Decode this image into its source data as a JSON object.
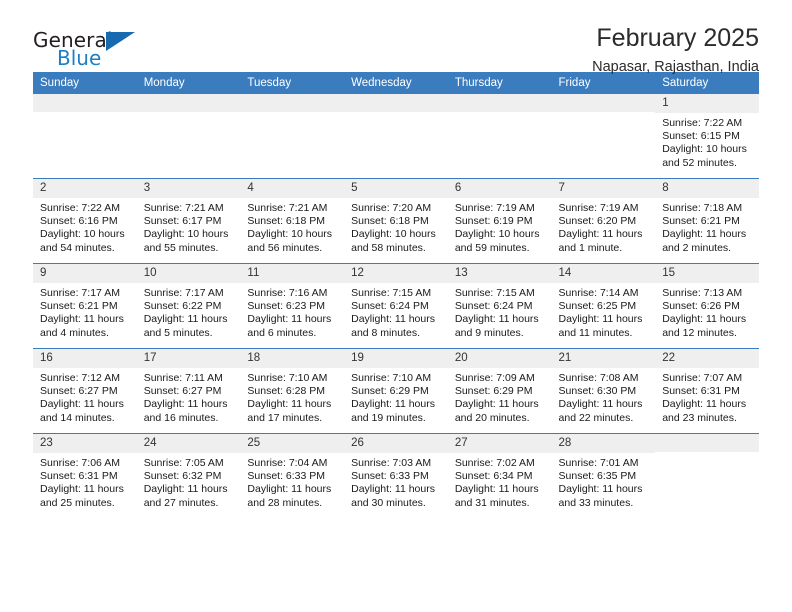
{
  "brand": {
    "name_part1": "General",
    "name_part2": "Blue",
    "triangle_color": "#1769b0",
    "blue_text_color": "#1c7fc4"
  },
  "header": {
    "title": "February 2025",
    "subtitle": "Napasar, Rajasthan, India"
  },
  "theme": {
    "header_blue": "#3b7cbe",
    "daynum_band": "#efefef",
    "text": "#1a1a1a"
  },
  "weekday_headers": [
    "Sunday",
    "Monday",
    "Tuesday",
    "Wednesday",
    "Thursday",
    "Friday",
    "Saturday"
  ],
  "weeks": [
    [
      {
        "day": "",
        "sunrise": "",
        "sunset": "",
        "daylight": "",
        "empty": true
      },
      {
        "day": "",
        "sunrise": "",
        "sunset": "",
        "daylight": "",
        "empty": true
      },
      {
        "day": "",
        "sunrise": "",
        "sunset": "",
        "daylight": "",
        "empty": true
      },
      {
        "day": "",
        "sunrise": "",
        "sunset": "",
        "daylight": "",
        "empty": true
      },
      {
        "day": "",
        "sunrise": "",
        "sunset": "",
        "daylight": "",
        "empty": true
      },
      {
        "day": "",
        "sunrise": "",
        "sunset": "",
        "daylight": "",
        "empty": true
      },
      {
        "day": "1",
        "sunrise": "Sunrise: 7:22 AM",
        "sunset": "Sunset: 6:15 PM",
        "daylight": "Daylight: 10 hours and 52 minutes.",
        "empty": false
      }
    ],
    [
      {
        "day": "2",
        "sunrise": "Sunrise: 7:22 AM",
        "sunset": "Sunset: 6:16 PM",
        "daylight": "Daylight: 10 hours and 54 minutes.",
        "empty": false
      },
      {
        "day": "3",
        "sunrise": "Sunrise: 7:21 AM",
        "sunset": "Sunset: 6:17 PM",
        "daylight": "Daylight: 10 hours and 55 minutes.",
        "empty": false
      },
      {
        "day": "4",
        "sunrise": "Sunrise: 7:21 AM",
        "sunset": "Sunset: 6:18 PM",
        "daylight": "Daylight: 10 hours and 56 minutes.",
        "empty": false
      },
      {
        "day": "5",
        "sunrise": "Sunrise: 7:20 AM",
        "sunset": "Sunset: 6:18 PM",
        "daylight": "Daylight: 10 hours and 58 minutes.",
        "empty": false
      },
      {
        "day": "6",
        "sunrise": "Sunrise: 7:19 AM",
        "sunset": "Sunset: 6:19 PM",
        "daylight": "Daylight: 10 hours and 59 minutes.",
        "empty": false
      },
      {
        "day": "7",
        "sunrise": "Sunrise: 7:19 AM",
        "sunset": "Sunset: 6:20 PM",
        "daylight": "Daylight: 11 hours and 1 minute.",
        "empty": false
      },
      {
        "day": "8",
        "sunrise": "Sunrise: 7:18 AM",
        "sunset": "Sunset: 6:21 PM",
        "daylight": "Daylight: 11 hours and 2 minutes.",
        "empty": false
      }
    ],
    [
      {
        "day": "9",
        "sunrise": "Sunrise: 7:17 AM",
        "sunset": "Sunset: 6:21 PM",
        "daylight": "Daylight: 11 hours and 4 minutes.",
        "empty": false
      },
      {
        "day": "10",
        "sunrise": "Sunrise: 7:17 AM",
        "sunset": "Sunset: 6:22 PM",
        "daylight": "Daylight: 11 hours and 5 minutes.",
        "empty": false
      },
      {
        "day": "11",
        "sunrise": "Sunrise: 7:16 AM",
        "sunset": "Sunset: 6:23 PM",
        "daylight": "Daylight: 11 hours and 6 minutes.",
        "empty": false
      },
      {
        "day": "12",
        "sunrise": "Sunrise: 7:15 AM",
        "sunset": "Sunset: 6:24 PM",
        "daylight": "Daylight: 11 hours and 8 minutes.",
        "empty": false
      },
      {
        "day": "13",
        "sunrise": "Sunrise: 7:15 AM",
        "sunset": "Sunset: 6:24 PM",
        "daylight": "Daylight: 11 hours and 9 minutes.",
        "empty": false
      },
      {
        "day": "14",
        "sunrise": "Sunrise: 7:14 AM",
        "sunset": "Sunset: 6:25 PM",
        "daylight": "Daylight: 11 hours and 11 minutes.",
        "empty": false
      },
      {
        "day": "15",
        "sunrise": "Sunrise: 7:13 AM",
        "sunset": "Sunset: 6:26 PM",
        "daylight": "Daylight: 11 hours and 12 minutes.",
        "empty": false
      }
    ],
    [
      {
        "day": "16",
        "sunrise": "Sunrise: 7:12 AM",
        "sunset": "Sunset: 6:27 PM",
        "daylight": "Daylight: 11 hours and 14 minutes.",
        "empty": false
      },
      {
        "day": "17",
        "sunrise": "Sunrise: 7:11 AM",
        "sunset": "Sunset: 6:27 PM",
        "daylight": "Daylight: 11 hours and 16 minutes.",
        "empty": false
      },
      {
        "day": "18",
        "sunrise": "Sunrise: 7:10 AM",
        "sunset": "Sunset: 6:28 PM",
        "daylight": "Daylight: 11 hours and 17 minutes.",
        "empty": false
      },
      {
        "day": "19",
        "sunrise": "Sunrise: 7:10 AM",
        "sunset": "Sunset: 6:29 PM",
        "daylight": "Daylight: 11 hours and 19 minutes.",
        "empty": false
      },
      {
        "day": "20",
        "sunrise": "Sunrise: 7:09 AM",
        "sunset": "Sunset: 6:29 PM",
        "daylight": "Daylight: 11 hours and 20 minutes.",
        "empty": false
      },
      {
        "day": "21",
        "sunrise": "Sunrise: 7:08 AM",
        "sunset": "Sunset: 6:30 PM",
        "daylight": "Daylight: 11 hours and 22 minutes.",
        "empty": false
      },
      {
        "day": "22",
        "sunrise": "Sunrise: 7:07 AM",
        "sunset": "Sunset: 6:31 PM",
        "daylight": "Daylight: 11 hours and 23 minutes.",
        "empty": false
      }
    ],
    [
      {
        "day": "23",
        "sunrise": "Sunrise: 7:06 AM",
        "sunset": "Sunset: 6:31 PM",
        "daylight": "Daylight: 11 hours and 25 minutes.",
        "empty": false
      },
      {
        "day": "24",
        "sunrise": "Sunrise: 7:05 AM",
        "sunset": "Sunset: 6:32 PM",
        "daylight": "Daylight: 11 hours and 27 minutes.",
        "empty": false
      },
      {
        "day": "25",
        "sunrise": "Sunrise: 7:04 AM",
        "sunset": "Sunset: 6:33 PM",
        "daylight": "Daylight: 11 hours and 28 minutes.",
        "empty": false
      },
      {
        "day": "26",
        "sunrise": "Sunrise: 7:03 AM",
        "sunset": "Sunset: 6:33 PM",
        "daylight": "Daylight: 11 hours and 30 minutes.",
        "empty": false
      },
      {
        "day": "27",
        "sunrise": "Sunrise: 7:02 AM",
        "sunset": "Sunset: 6:34 PM",
        "daylight": "Daylight: 11 hours and 31 minutes.",
        "empty": false
      },
      {
        "day": "28",
        "sunrise": "Sunrise: 7:01 AM",
        "sunset": "Sunset: 6:35 PM",
        "daylight": "Daylight: 11 hours and 33 minutes.",
        "empty": false
      },
      {
        "day": "",
        "sunrise": "",
        "sunset": "",
        "daylight": "",
        "empty": true
      }
    ]
  ]
}
